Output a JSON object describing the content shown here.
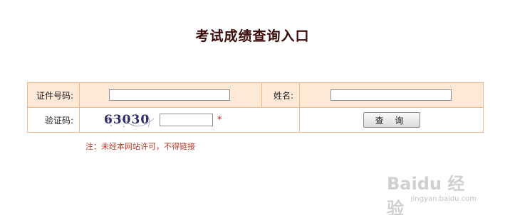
{
  "title": "考试成绩查询入口",
  "form": {
    "id_label": "证件号码:",
    "id_value": "",
    "name_label": "姓名:",
    "name_value": "",
    "captcha_label": "验证码:",
    "captcha_text": "63030",
    "captcha_value": "",
    "required_mark": "*",
    "query_button": "查 询"
  },
  "note": "注：未经本网站许可，不得链接",
  "watermark": {
    "brand": "Baidu 经验",
    "url": "jingyan.baidu.com"
  },
  "colors": {
    "title": "#3b0a0a",
    "label_bg": "#fde9d6",
    "border": "#f0b98a",
    "note": "#c0392b",
    "required": "#d32020"
  }
}
